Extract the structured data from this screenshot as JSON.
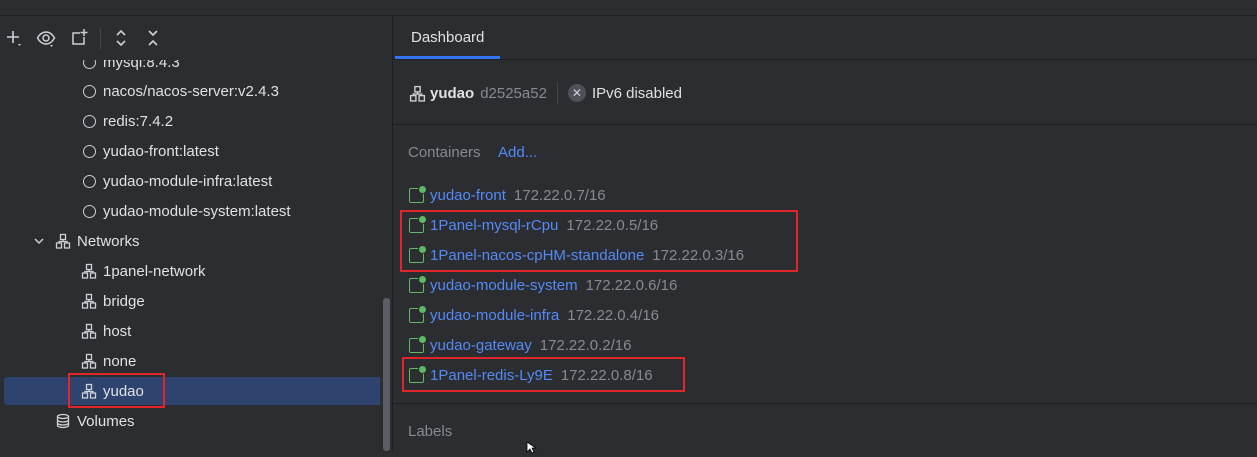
{
  "toolbar": {
    "icons": [
      "add-icon",
      "eye-icon",
      "new-window-icon",
      "expand-icon",
      "collapse-icon"
    ]
  },
  "tree": {
    "images": [
      "mysql:8.4.3",
      "nacos/nacos-server:v2.4.3",
      "redis:7.4.2",
      "yudao-front:latest",
      "yudao-module-infra:latest",
      "yudao-module-system:latest"
    ],
    "networks_label": "Networks",
    "networks": [
      "1panel-network",
      "bridge",
      "host",
      "none",
      "yudao"
    ],
    "selected_network": "yudao",
    "volumes_label": "Volumes"
  },
  "tabs": [
    {
      "label": "Dashboard",
      "active": true
    }
  ],
  "network": {
    "name": "yudao",
    "id": "d2525a52",
    "ipv6_status": "IPv6 disabled"
  },
  "containers": {
    "label": "Containers",
    "add_label": "Add...",
    "items": [
      {
        "name": "yudao-front",
        "ip": "172.22.0.7/16"
      },
      {
        "name": "1Panel-mysql-rCpu",
        "ip": "172.22.0.5/16"
      },
      {
        "name": "1Panel-nacos-cpHM-standalone",
        "ip": "172.22.0.3/16"
      },
      {
        "name": "yudao-module-system",
        "ip": "172.22.0.6/16"
      },
      {
        "name": "yudao-module-infra",
        "ip": "172.22.0.4/16"
      },
      {
        "name": "yudao-gateway",
        "ip": "172.22.0.2/16"
      },
      {
        "name": "1Panel-redis-Ly9E",
        "ip": "172.22.0.8/16"
      }
    ]
  },
  "labels": {
    "label": "Labels"
  },
  "colors": {
    "background": "#2b2d30",
    "link": "#548af7",
    "muted": "#868a91",
    "selection": "#2e436e",
    "accent": "#3574f0",
    "running": "#5fb865",
    "highlight": "#e0262a"
  }
}
